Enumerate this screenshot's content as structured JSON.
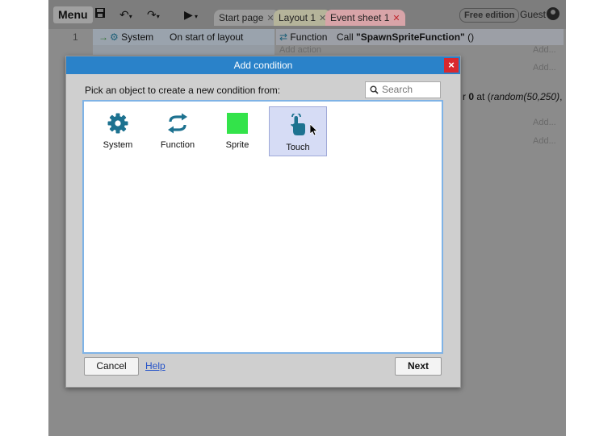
{
  "toolbar": {
    "menu_label": "Menu",
    "tabs": [
      {
        "label": "Start page"
      },
      {
        "label": "Layout 1"
      },
      {
        "label": "Event sheet 1"
      }
    ],
    "edition_badge": "Free edition",
    "user_label": "Guest"
  },
  "event_sheet": {
    "row_number": "1",
    "condition_object": "System",
    "condition_text": "On start of layout",
    "action_object": "Function",
    "action_text_prefix": "Call ",
    "action_text_name": "\"SpawnSpriteFunction\"",
    "action_text_suffix": " ()",
    "add_action": "Add action",
    "add_labels": [
      "Add...",
      "Add...",
      "Add...",
      "Add..."
    ],
    "fragment_prefix": "r ",
    "fragment_bold": "0",
    "fragment_mid": " at (",
    "fragment_italic": "random(50,250)",
    "fragment_suffix": ","
  },
  "dialog": {
    "title": "Add condition",
    "close_label": "×",
    "prompt": "Pick an object to create a new condition from:",
    "search_placeholder": "Search",
    "objects": [
      {
        "label": "System",
        "icon": "gear-icon"
      },
      {
        "label": "Function",
        "icon": "function-arrows-icon"
      },
      {
        "label": "Sprite",
        "icon": "sprite-square-icon"
      },
      {
        "label": "Touch",
        "icon": "touch-hand-icon",
        "selected": true
      }
    ],
    "cancel_label": "Cancel",
    "help_label": "Help",
    "next_label": "Next"
  },
  "colors": {
    "title_bar": "#2a82c9",
    "close_button": "#d9282e",
    "icon_teal": "#1d7290",
    "sprite_green": "#33e34a",
    "selection": "#d6dcf5"
  }
}
